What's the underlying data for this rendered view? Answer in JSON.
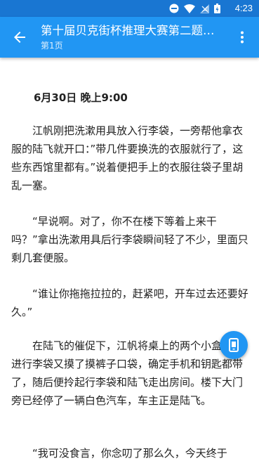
{
  "status_bar": {
    "time": "4:23",
    "icons": [
      "do-not-disturb-icon",
      "wifi-icon",
      "signal-icon",
      "battery-icon"
    ]
  },
  "app_bar": {
    "title": "第十届贝克街杯推理大赛第二题…",
    "subtitle": "第1页",
    "back_icon": "arrow-back-icon",
    "menu_icon": "more-vert-icon"
  },
  "content": {
    "date_line": "6月30日 晚上9:00",
    "paragraphs": [
      "江帆刚把洗漱用具放入行李袋，一旁帮他拿衣服的陆飞就开口：”带几件要换洗的衣服就行了，这些东西馆里都有。”说着便把手上的衣服往袋子里胡乱一塞。",
      "“早说啊。对了，你不在楼下等着上来干吗？”拿出洗漱用具后行李袋瞬间轻了不少，里面只剩几套便服。",
      "“谁让你拖拖拉拉的，赶紧吧，开车过去还要好久。”",
      "在陆飞的催促下，江帆将桌上的两个小盒子放进行李袋又摸了摸裤子口袋，确定手机和钥匙都带了，随后便拎起行李袋和陆飞走出房间。楼下大门旁已经停了一辆白色汽车，车主正是陆飞。",
      "“我可没食言，你念叨了那么久，今天终于"
    ]
  },
  "fab": {
    "icon": "phone-reader-icon"
  },
  "colors": {
    "app_bar": "#2196f3",
    "status_bar": "#1976d2",
    "text": "#222222"
  }
}
